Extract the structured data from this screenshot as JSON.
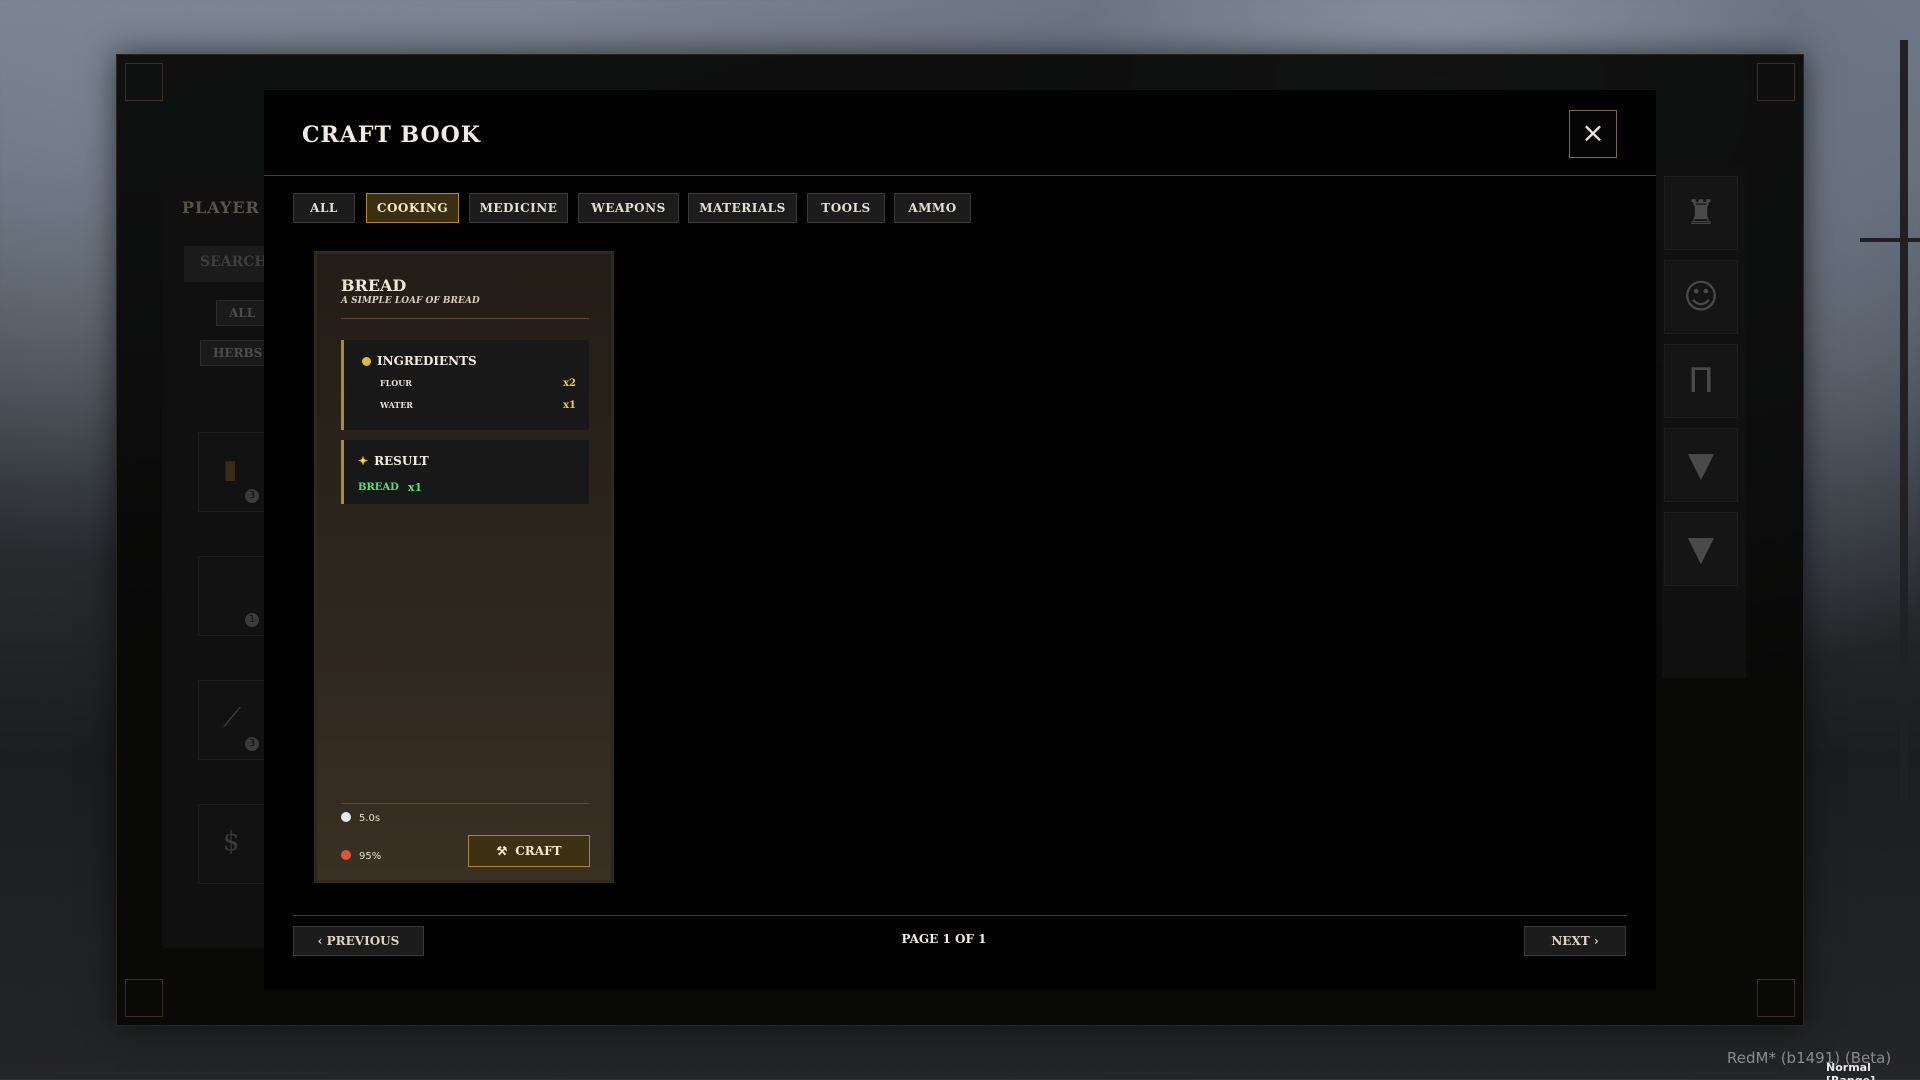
{
  "inventory_bg": {
    "title": "PLAYER",
    "search_placeholder": "SEARCH",
    "chips": [
      "ALL",
      "HERBS"
    ],
    "slot_counts": [
      "3",
      "1",
      "3"
    ]
  },
  "craftbook": {
    "title": "CRAFT BOOK",
    "close_icon": "close-icon",
    "tabs": [
      {
        "label": "ALL",
        "active": false
      },
      {
        "label": "COOKING",
        "active": true
      },
      {
        "label": "MEDICINE",
        "active": false
      },
      {
        "label": "WEAPONS",
        "active": false
      },
      {
        "label": "MATERIALS",
        "active": false
      },
      {
        "label": "TOOLS",
        "active": false
      },
      {
        "label": "AMMO",
        "active": false
      }
    ],
    "recipe": {
      "name": "BREAD",
      "description": "A SIMPLE LOAF OF BREAD",
      "ingredients_title": "INGREDIENTS",
      "ingredients": [
        {
          "name": "FLOUR",
          "qty": "x2"
        },
        {
          "name": "WATER",
          "qty": "x1"
        }
      ],
      "result_title": "RESULT",
      "result": {
        "name": "BREAD",
        "qty": "x1"
      },
      "time": "5.0s",
      "success": "95%",
      "craft_label": "CRAFT"
    },
    "pagination": {
      "previous": "‹ PREVIOUS",
      "page_label": "PAGE 1 OF 1",
      "next": "NEXT ›"
    }
  },
  "build": {
    "info": "RedM* (b1491) (Beta)",
    "mode": "Normal [Range]"
  },
  "colors": {
    "accent": "#b08a2c",
    "result_green": "#4fe07a",
    "qty_yellow": "#f4cd3c"
  }
}
